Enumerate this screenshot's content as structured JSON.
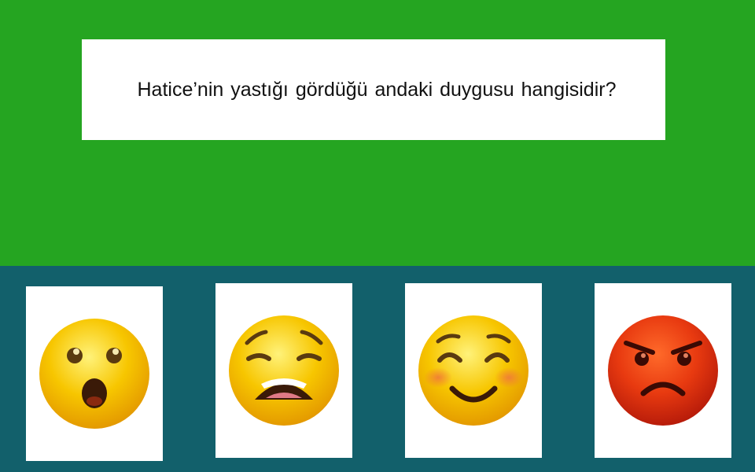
{
  "colors": {
    "top_background": "#25a521",
    "bottom_background": "#12606b",
    "card_background": "#ffffff",
    "face_yellow": "#f5c400",
    "face_red": "#e23a10"
  },
  "question": {
    "text": "Hatice’nin yastığı gördüğü andaki duygusu hangisidir?"
  },
  "options": [
    {
      "icon": "surprised-face-icon"
    },
    {
      "icon": "weary-face-icon"
    },
    {
      "icon": "smiling-blushing-face-icon"
    },
    {
      "icon": "angry-face-icon"
    }
  ]
}
